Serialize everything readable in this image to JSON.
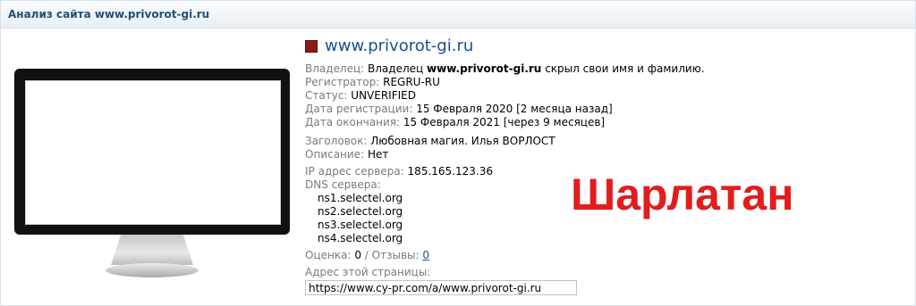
{
  "header": {
    "title": "Анализ сайта www.privorot-gi.ru"
  },
  "site": {
    "name": "www.privorot-gi.ru",
    "icon": "favicon-square-icon",
    "icon_color": "#8b1a1a"
  },
  "owner": {
    "label": "Владелец:",
    "prefix": "Владелец",
    "domain": "www.privorot-gi.ru",
    "suffix": "скрыл свои имя и фамилию."
  },
  "registrar": {
    "label": "Регистратор:",
    "value": "REGRU-RU"
  },
  "status": {
    "label": "Статус:",
    "value": "UNVERIFIED"
  },
  "reg_date": {
    "label": "Дата регистрации:",
    "value": "15 Февраля 2020 [2 месяца назад]"
  },
  "exp_date": {
    "label": "Дата окончания:",
    "value": "15 Февраля 2021 [через 9 месяцев]"
  },
  "heading": {
    "label": "Заголовок:",
    "value": "Любовная магия. Илья ВОРЛОСТ"
  },
  "description": {
    "label": "Описание:",
    "value": "Нет"
  },
  "ip": {
    "label": "IP адрес сервера:",
    "value": "185.165.123.36"
  },
  "dns": {
    "label": "DNS сервера:",
    "servers": [
      "ns1.selectel.org",
      "ns2.selectel.org",
      "ns3.selectel.org",
      "ns4.selectel.org"
    ]
  },
  "rating": {
    "label": "Оценка:",
    "value": "0",
    "separator": "/",
    "reviews_label": "Отзывы:",
    "reviews_value": "0"
  },
  "page_address": {
    "label": "Адрес этой страницы:",
    "value": "https://www.cy-pr.com/a/www.privorot-gi.ru"
  },
  "stamp": {
    "text": "Шарлатан",
    "color": "#e31c1c"
  },
  "colors": {
    "header_text": "#1f4f7c",
    "link": "#1b4f8e",
    "label": "#7a7a7a"
  }
}
